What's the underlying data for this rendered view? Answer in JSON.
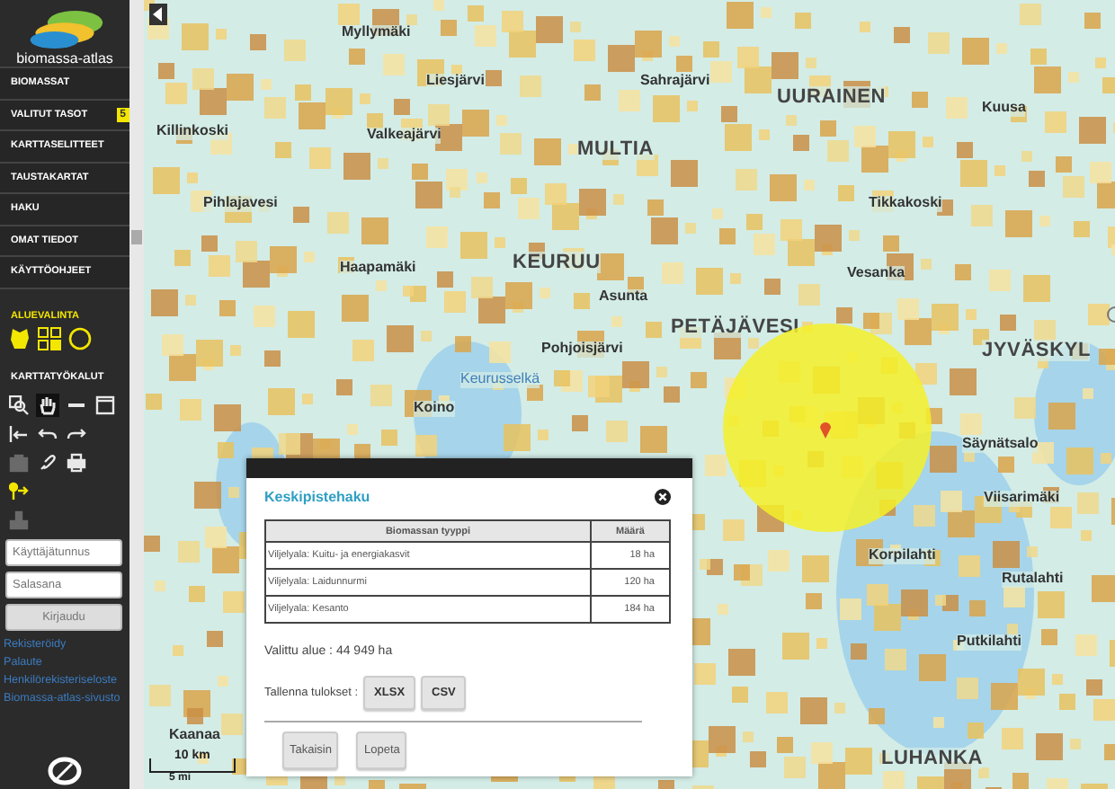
{
  "sidebar": {
    "logo_text": "biomassa-atlas",
    "menu": [
      {
        "label": "BIOMASSAT"
      },
      {
        "label": "VALITUT TASOT",
        "badge": "5"
      },
      {
        "label": "KARTTASELITTEET"
      },
      {
        "label": "TAUSTAKARTAT"
      },
      {
        "label": "HAKU"
      },
      {
        "label": "OMAT TIEDOT"
      },
      {
        "label": "KÄYTTÖOHJEET"
      }
    ],
    "area_selection": {
      "title": "ALUEVALINTA",
      "tools": [
        {
          "kind": "region"
        },
        {
          "kind": "grid"
        },
        {
          "kind": "circle"
        }
      ]
    },
    "map_tools": {
      "title": "KARTTATYÖKALUT",
      "rows": [
        [
          {
            "kind": "zoom-box",
            "selected": false,
            "disabled": false
          },
          {
            "kind": "hand",
            "selected": true,
            "disabled": false
          },
          {
            "kind": "line",
            "selected": false,
            "disabled": false
          },
          {
            "kind": "window",
            "selected": false,
            "disabled": false
          }
        ],
        [
          {
            "kind": "first",
            "selected": false,
            "disabled": false
          },
          {
            "kind": "undo",
            "selected": false,
            "disabled": false
          },
          {
            "kind": "redo",
            "selected": false,
            "disabled": false
          }
        ],
        [
          {
            "kind": "camera",
            "selected": false,
            "disabled": true
          },
          {
            "kind": "link",
            "selected": false,
            "disabled": false
          },
          {
            "kind": "printer",
            "selected": false,
            "disabled": false
          }
        ],
        [
          {
            "kind": "pin",
            "selected": false,
            "disabled": false
          }
        ],
        [
          {
            "kind": "stamp",
            "selected": false,
            "disabled": true
          }
        ]
      ]
    },
    "login": {
      "username_placeholder": "Käyttäjätunnus",
      "password_placeholder": "Salasana",
      "button": "Kirjaudu"
    },
    "links": [
      "Rekisteröidy",
      "Palaute",
      "Henkilörekisteriseloste",
      "Biomassa-atlas-sivusto"
    ]
  },
  "map": {
    "places": [
      {
        "name": "Myllymäki",
        "kind": "village"
      },
      {
        "name": "Liesjärvi",
        "kind": "village"
      },
      {
        "name": "Sahrajärvi",
        "kind": "village"
      },
      {
        "name": "UURAINEN",
        "kind": "town"
      },
      {
        "name": "Kuusa",
        "kind": "village"
      },
      {
        "name": "Killinkoski",
        "kind": "village"
      },
      {
        "name": "Valkeajärvi",
        "kind": "village"
      },
      {
        "name": "MULTIA",
        "kind": "town"
      },
      {
        "name": "Pihlajavesi",
        "kind": "village"
      },
      {
        "name": "Tikkakoski",
        "kind": "village"
      },
      {
        "name": "Haapamäki",
        "kind": "village"
      },
      {
        "name": "KEURUU",
        "kind": "town"
      },
      {
        "name": "Vesanka",
        "kind": "village"
      },
      {
        "name": "Asunta",
        "kind": "village"
      },
      {
        "name": "PETÄJÄVESI",
        "kind": "town"
      },
      {
        "name": "JYVÄSKYL",
        "kind": "town"
      },
      {
        "name": "Pohjoisjärvi",
        "kind": "village"
      },
      {
        "name": "Keurusselkä",
        "kind": "water"
      },
      {
        "name": "Koino",
        "kind": "village"
      },
      {
        "name": "Säynätsalo",
        "kind": "village"
      },
      {
        "name": "Viisarimäki",
        "kind": "village"
      },
      {
        "name": "Korpilahti",
        "kind": "village"
      },
      {
        "name": "Rutalahti",
        "kind": "village"
      },
      {
        "name": "Putkilahti",
        "kind": "village"
      },
      {
        "name": "Kaanaa",
        "kind": "village"
      },
      {
        "name": "LUHANKA",
        "kind": "town"
      }
    ],
    "scale": [
      "10 km",
      "5 mi"
    ]
  },
  "dialog": {
    "title": "Keskipistehaku",
    "columns": [
      "Biomassan tyyppi",
      "Määrä"
    ],
    "rows": [
      [
        "Viljelyala: Kuitu- ja energiakasvit",
        "18 ha"
      ],
      [
        "Viljelyala: Laidunnurmi",
        "120 ha"
      ],
      [
        "Viljelyala: Kesanto",
        "184 ha"
      ]
    ],
    "selected_area": "Valittu alue : 44 949 ha",
    "save_label": "Tallenna tulokset :",
    "exports": [
      "XLSX",
      "CSV"
    ],
    "buttons": [
      "Takaisin",
      "Lopeta"
    ]
  }
}
